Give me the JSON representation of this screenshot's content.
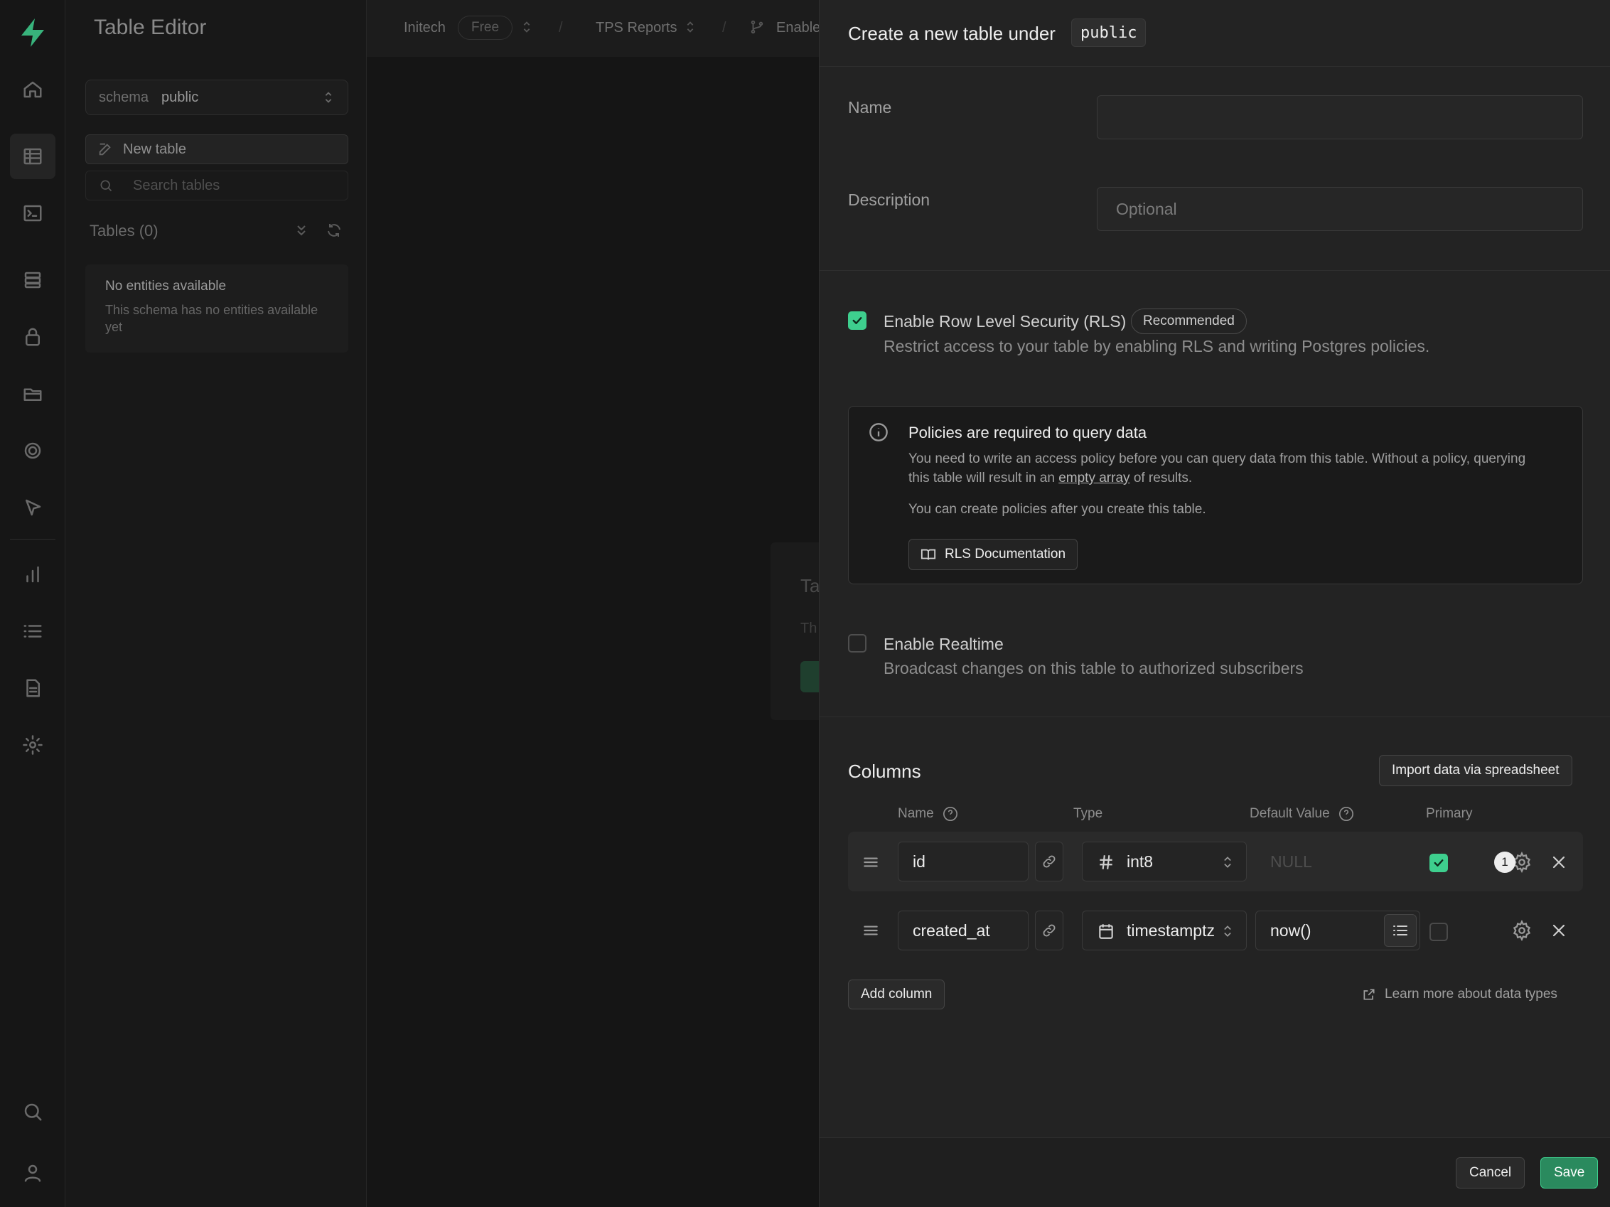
{
  "sidebar": {
    "title": "Table Editor",
    "schema_key": "schema",
    "schema_value": "public",
    "new_table": "New table",
    "search_placeholder": "Search tables",
    "tables_heading": "Tables (0)",
    "empty_title": "No entities available",
    "empty_desc": "This schema has no entities available yet"
  },
  "topbar": {
    "org": "Initech",
    "plan": "Free",
    "project": "TPS Reports",
    "branch": "Enable"
  },
  "background_card": {
    "title": "Ta",
    "subtitle": "Th"
  },
  "sheet": {
    "title": "Create a new table under",
    "schema": "public",
    "name_label": "Name",
    "name_value": "",
    "description_label": "Description",
    "description_placeholder": "Optional",
    "rls": {
      "checked": true,
      "title": "Enable Row Level Security (RLS)",
      "badge": "Recommended",
      "desc": "Restrict access to your table by enabling RLS and writing Postgres policies."
    },
    "alert": {
      "title": "Policies are required to query data",
      "text_a": "You need to write an access policy before you can query data from this table. Without a policy, querying this table will result in an",
      "link": "empty array",
      "text_b": "of results.",
      "text2": "You can create policies after you create this table.",
      "button": "RLS Documentation"
    },
    "realtime": {
      "checked": false,
      "title": "Enable Realtime",
      "desc": "Broadcast changes on this table to authorized subscribers"
    },
    "columns": {
      "title": "Columns",
      "import_button": "Import data via spreadsheet",
      "headers": [
        "Name",
        "Type",
        "Default Value",
        "Primary"
      ],
      "rows": [
        {
          "name": "id",
          "type": "int8",
          "type_icon": "hash-icon",
          "default": "NULL",
          "primary": true,
          "count": "1"
        },
        {
          "name": "created_at",
          "type": "timestamptz",
          "type_icon": "calendar-icon",
          "default": "now()",
          "primary": false
        }
      ],
      "add_button": "Add column",
      "learn_link": "Learn more about data types"
    },
    "footer": {
      "cancel": "Cancel",
      "save": "Save"
    }
  },
  "colors": {
    "accent": "#3ecf8e",
    "save_bg": "#2a8a5e",
    "panel_bg": "#232323"
  }
}
